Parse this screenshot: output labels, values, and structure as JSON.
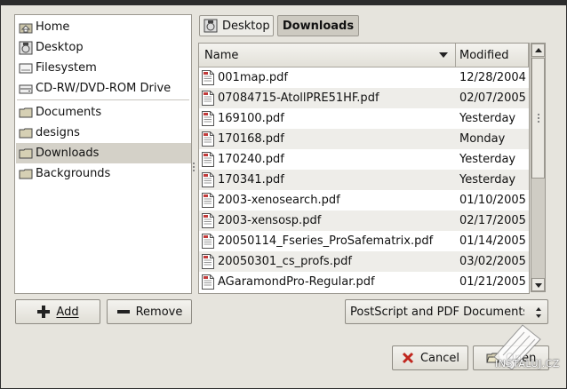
{
  "places": {
    "items": [
      {
        "label": "Home",
        "icon": "home-folder-icon"
      },
      {
        "label": "Desktop",
        "icon": "desktop-icon"
      },
      {
        "label": "Filesystem",
        "icon": "filesystem-icon"
      },
      {
        "label": "CD-RW/DVD-ROM Drive",
        "icon": "optical-drive-icon"
      }
    ],
    "bookmarks": [
      {
        "label": "Documents"
      },
      {
        "label": "designs"
      },
      {
        "label": "Downloads",
        "selected": true
      },
      {
        "label": "Backgrounds"
      }
    ]
  },
  "path_bar": {
    "items": [
      {
        "label": "Desktop"
      },
      {
        "label": "Downloads",
        "active": true
      }
    ]
  },
  "file_list": {
    "col_name": "Name",
    "col_modified": "Modified",
    "files": [
      {
        "name": "001map.pdf",
        "modified": "12/28/2004"
      },
      {
        "name": "07084715-AtollPRE51HF.pdf",
        "modified": "02/07/2005"
      },
      {
        "name": "169100.pdf",
        "modified": "Yesterday"
      },
      {
        "name": "170168.pdf",
        "modified": "Monday"
      },
      {
        "name": "170240.pdf",
        "modified": "Yesterday"
      },
      {
        "name": "170341.pdf",
        "modified": "Yesterday"
      },
      {
        "name": "2003-xenosearch.pdf",
        "modified": "01/10/2005"
      },
      {
        "name": "2003-xensosp.pdf",
        "modified": "02/17/2005"
      },
      {
        "name": "20050114_Fseries_ProSafematrix.pdf",
        "modified": "01/14/2005"
      },
      {
        "name": "20050301_cs_profs.pdf",
        "modified": "03/02/2005"
      },
      {
        "name": "AGaramondPro-Regular.pdf",
        "modified": "01/21/2005"
      }
    ]
  },
  "buttons": {
    "add": "Add",
    "remove": "Remove",
    "cancel": "Cancel",
    "open": "Open"
  },
  "filter": {
    "selected": "PostScript and PDF Documents"
  },
  "watermark": {
    "text": "INSTALUJ.CZ"
  },
  "colors": {
    "window_bg": "#e6e4dd",
    "selection": "#d4d1c8",
    "alt_row": "#eeede9",
    "cancel_x": "#c0261e"
  }
}
